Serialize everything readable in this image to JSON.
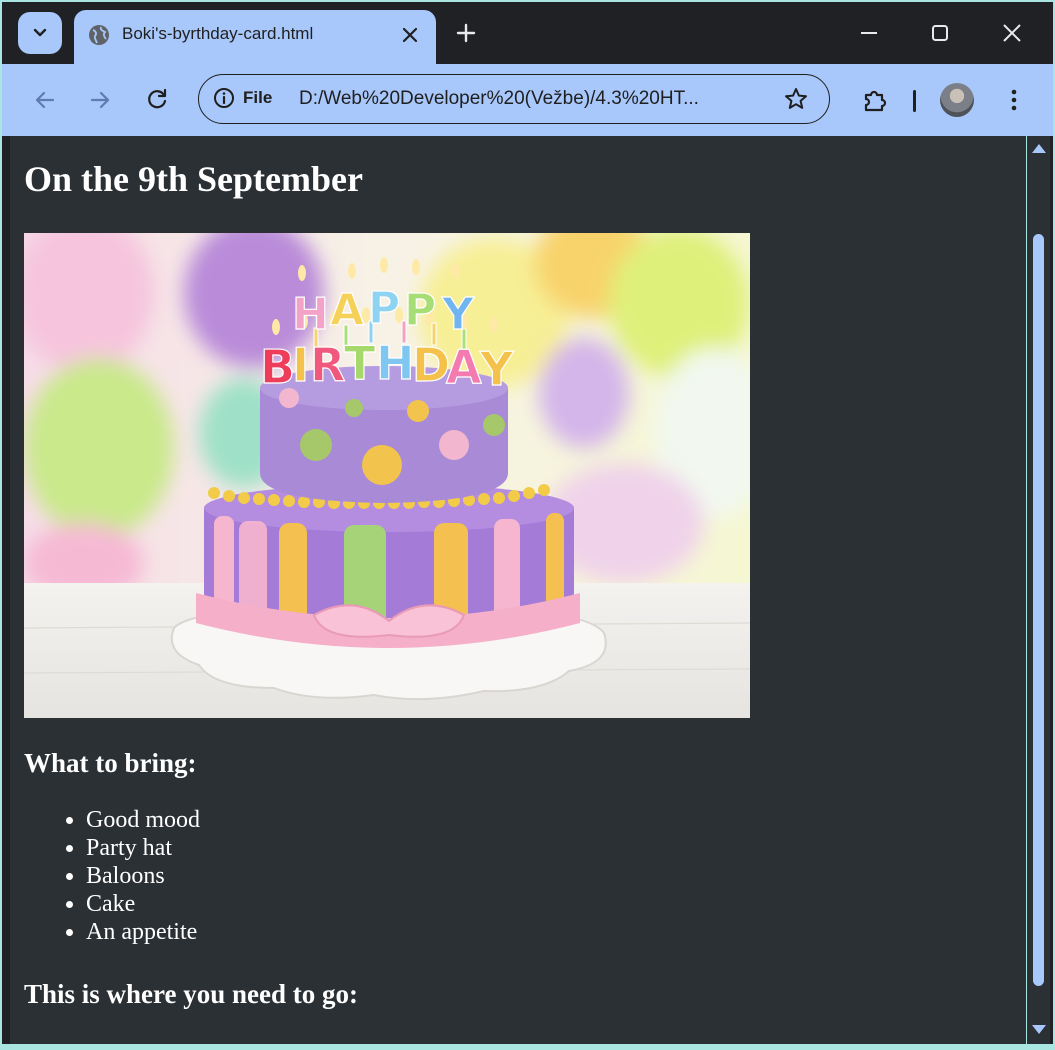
{
  "browser": {
    "tab": {
      "title": "Boki's-byrthday-card.html"
    },
    "omnibox": {
      "site_label": "File",
      "url": "D:/Web%20Developer%20(Vežbe)/4.3%20HT..."
    }
  },
  "icons": {
    "tab_search": "chevron-down-icon",
    "favicon": "globe-icon",
    "tab_close": "close-icon",
    "new_tab": "plus-icon",
    "minimize": "minimize-icon",
    "maximize": "maximize-icon",
    "close_window": "close-icon",
    "back": "arrow-left-icon",
    "forward": "arrow-right-icon",
    "reload": "reload-icon",
    "site_info": "info-icon",
    "bookmark": "star-icon",
    "extensions": "puzzle-icon",
    "menu": "kebab-menu-icon"
  },
  "page": {
    "title": "On the 9th September",
    "image_text": "HAPPY BIRTHDAY",
    "bring_heading": "What to bring:",
    "bring_items": [
      "Good mood",
      "Party hat",
      "Baloons",
      "Cake",
      "An appetite"
    ],
    "go_heading": "This is where you need to go:"
  },
  "colors": {
    "chrome_frame": "#202124",
    "tab_active": "#a8c7fa",
    "page_background": "#2b3035",
    "window_border": "#a9e6e2",
    "text": "#ffffff"
  }
}
